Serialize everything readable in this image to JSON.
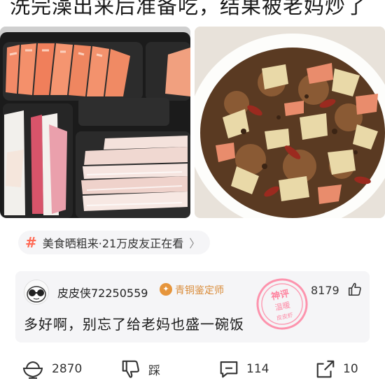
{
  "post": {
    "caption": "洗完澡出来后准备吃，结果被老妈炒了"
  },
  "topic": {
    "label": "美食晒粗来·21万皮友正在看"
  },
  "comment": {
    "username": "皮皮侠72250559",
    "badge": "青铜鉴定师",
    "stamp_lines": [
      "神评",
      "温暖",
      "皮皮虾"
    ],
    "likes": "8179",
    "text": "多好啊，别忘了给老妈也盛一碗饭"
  },
  "actions": {
    "upvotes": "2870",
    "dislike_label": "踩",
    "comments": "114",
    "shares": "10"
  }
}
